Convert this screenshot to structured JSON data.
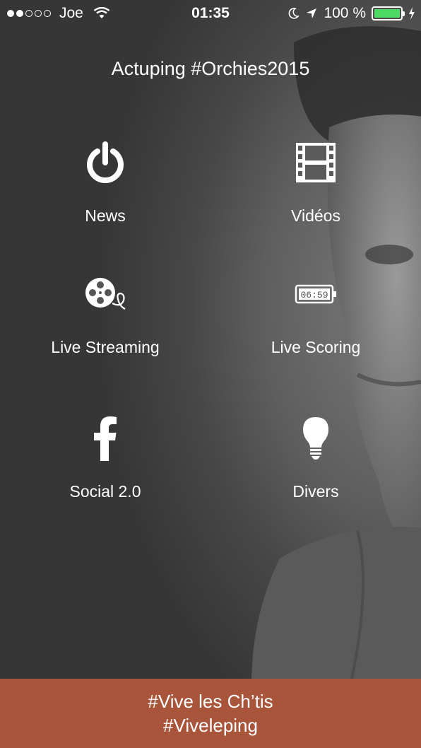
{
  "status_bar": {
    "carrier": "Joe",
    "time": "01:35",
    "battery": "100 %"
  },
  "title": "Actuping #Orchies2015",
  "menu": [
    {
      "label": "News",
      "icon": "power-icon"
    },
    {
      "label": "Vidéos",
      "icon": "film-strip-icon"
    },
    {
      "label": "Live Streaming",
      "icon": "film-reel-icon"
    },
    {
      "label": "Live Scoring",
      "icon": "digital-clock-icon",
      "clock_text": "06:59"
    },
    {
      "label": "Social 2.0",
      "icon": "facebook-icon"
    },
    {
      "label": "Divers",
      "icon": "light-bulb-icon"
    }
  ],
  "banner": {
    "line1": "#Vive les Ch’tis",
    "line2": "#Viveleping",
    "color": "#a8553c"
  }
}
